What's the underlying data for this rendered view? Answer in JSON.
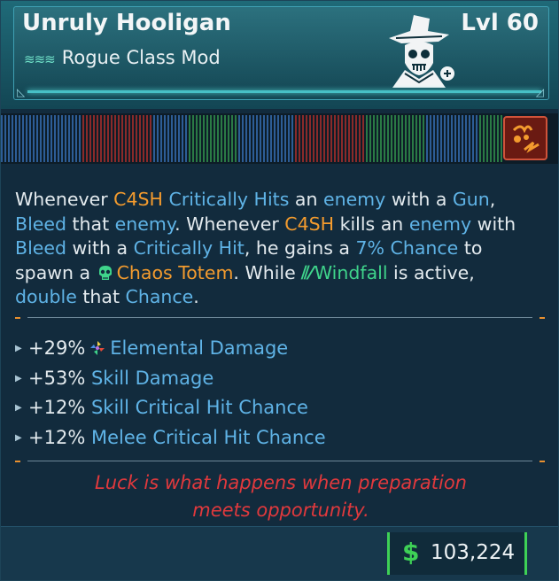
{
  "item": {
    "name": "Unruly Hooligan",
    "level": "Lvl 60",
    "type": "Rogue Class Mod",
    "rarity_icon": "rarity-chevrons-icon",
    "emblem_icon": "hooligan-skull-hat-icon",
    "ability_icon": "ability-fire-icon"
  },
  "description": {
    "s1": "Whenever ",
    "c4sh1": "C4SH",
    "s2": " ",
    "critically_hits": "Critically Hits",
    "s3": " an ",
    "enemy1": "enemy",
    "s4": " with a ",
    "gun": "Gun",
    "s5": ",",
    "bleed1": "Bleed",
    "s6": " that ",
    "enemy2": "enemy",
    "s7": ". Whenever ",
    "c4sh2": "C4SH",
    "s8": " kills an ",
    "enemy3": "enemy",
    "s9": " with",
    "bleed2": "Bleed",
    "s10": " with a ",
    "critically_hit": "Critically Hit",
    "s11": ", he gains a ",
    "chance_pct": "7% Chance",
    "s12": " to",
    "s13": "spawn a ",
    "chaos_totem": "Chaos Totem",
    "s14": ". While ",
    "windfall": "Windfall",
    "s15": " is active,",
    "double": "double",
    "s16": " that ",
    "chance2": "Chance",
    "s17": "."
  },
  "stats": [
    {
      "value": "+29%",
      "label": "Elemental Damage",
      "icon": "elemental-icon"
    },
    {
      "value": "+53%",
      "label": "Skill Damage"
    },
    {
      "value": "+12%",
      "label": "Skill Critical Hit Chance"
    },
    {
      "value": "+12%",
      "label": "Melee Critical Hit Chance"
    }
  ],
  "flavor": {
    "line1": "Luck is what happens when preparation",
    "line2": "meets opportunity."
  },
  "price": {
    "symbol": "$",
    "value": "103,224"
  },
  "colors": {
    "orange": "#f39b2e",
    "blue": "#5fb3e6",
    "green": "#3fd48b",
    "red": "#e0393d",
    "price_green": "#3ed156"
  }
}
